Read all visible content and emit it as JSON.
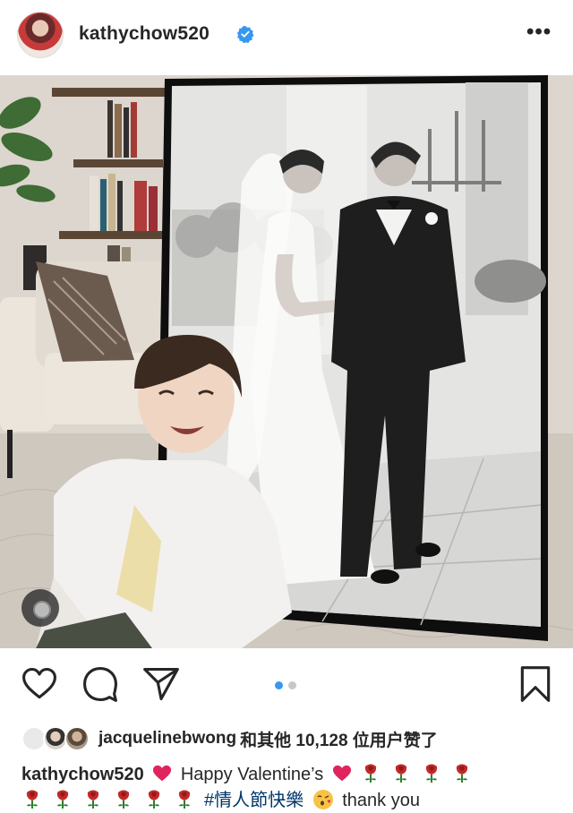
{
  "post": {
    "username": "kathychow520",
    "verified": true,
    "more_label": "•••",
    "image_count": 2,
    "current_image": 1
  },
  "likes": {
    "first_liker": "jacquelinebwong",
    "text": "和其他 10,128 位用户赞了"
  },
  "caption": {
    "username": "kathychow520",
    "text_part1": "Happy Valentine’s",
    "hashtag": "#情人節快樂",
    "text_end": "thank you",
    "emoji_sequence": [
      "red-heart",
      "rose",
      "rose",
      "rose",
      "rose",
      "rose",
      "rose",
      "rose",
      "rose",
      "rose",
      "rose",
      "kiss"
    ]
  },
  "icons": {
    "like": "heart-outline-icon",
    "comment": "comment-bubble-icon",
    "share": "paper-plane-icon",
    "save": "bookmark-icon",
    "verified": "verified-badge-icon",
    "more": "ellipsis-icon",
    "carousel": "carousel-indicator-icon"
  },
  "colors": {
    "verified_blue": "#3897f0",
    "active_dot": "#3897f0",
    "inactive_dot": "#c7c7c7",
    "text": "#262626",
    "hashtag": "#003569"
  }
}
